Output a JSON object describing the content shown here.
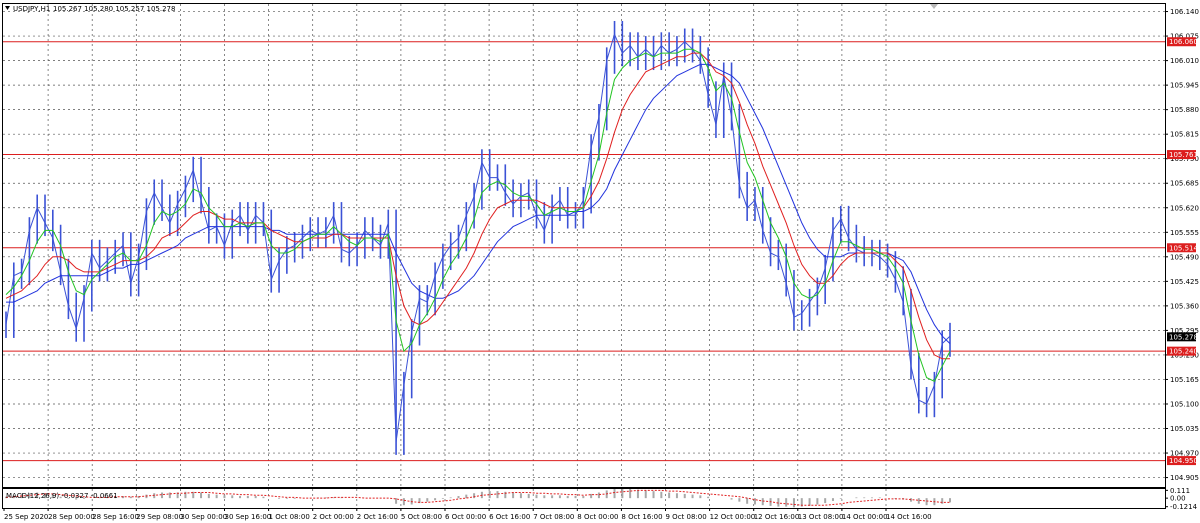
{
  "header": {
    "symbol_timeframe": "USDJPY,H1",
    "ohlc": "105.267 105.280 105.257 105.278"
  },
  "macd_label": "MACD(12,26,9) -0.0327 -0.0661",
  "colors": {
    "price": "#3b52d6",
    "fast_ma": "#22c422",
    "mid_ma": "#e02020",
    "slow_ma": "#2233dd",
    "level": "#dc1e1e",
    "current_price_tag": "#000000",
    "grid": "#555555",
    "macd_hist": "#a8a8a8",
    "macd_signal": "#e02020"
  },
  "chart_data": {
    "type": "line",
    "symbol": "USDJPY",
    "timeframe": "H1",
    "y_ticks": [
      "106.140",
      "106.075",
      "106.010",
      "105.945",
      "105.880",
      "105.815",
      "105.750",
      "105.685",
      "105.620",
      "105.555",
      "105.490",
      "105.425",
      "105.360",
      "105.295",
      "105.230",
      "105.165",
      "105.100",
      "105.035",
      "104.970",
      "104.905"
    ],
    "ylim": [
      104.88,
      106.16
    ],
    "x_ticks": [
      "25 Sep 2020",
      "28 Sep 00:00",
      "28 Sep 16:00",
      "29 Sep 08:00",
      "30 Sep 00:00",
      "30 Sep 16:00",
      "1 Oct 08:00",
      "2 Oct 00:00",
      "2 Oct 16:00",
      "5 Oct 08:00",
      "6 Oct 00:00",
      "6 Oct 16:00",
      "7 Oct 08:00",
      "8 Oct 00:00",
      "8 Oct 16:00",
      "9 Oct 08:00",
      "12 Oct 00:00",
      "12 Oct 16:00",
      "13 Oct 08:00",
      "14 Oct 00:00",
      "14 Oct 16:00"
    ],
    "levels": [
      {
        "label": "106.060",
        "value": 106.06
      },
      {
        "label": "105.761",
        "value": 105.761
      },
      {
        "label": "105.514",
        "value": 105.514
      },
      {
        "label": "105.240",
        "value": 105.24
      },
      {
        "label": "104.950",
        "value": 104.95
      }
    ],
    "current_price": "105.278",
    "price": [
      105.31,
      105.44,
      105.45,
      105.56,
      105.62,
      105.58,
      105.54,
      105.45,
      105.36,
      105.3,
      105.38,
      105.5,
      105.46,
      105.48,
      105.5,
      105.52,
      105.42,
      105.49,
      105.61,
      105.66,
      105.62,
      105.58,
      105.63,
      105.67,
      105.72,
      105.64,
      105.56,
      105.57,
      105.52,
      105.58,
      105.6,
      105.56,
      105.6,
      105.58,
      105.43,
      105.48,
      105.51,
      105.52,
      105.54,
      105.56,
      105.55,
      105.56,
      105.6,
      105.51,
      105.5,
      105.52,
      105.56,
      105.54,
      105.52,
      105.58,
      105.0,
      105.15,
      105.29,
      105.38,
      105.37,
      105.44,
      105.49,
      105.52,
      105.54,
      105.6,
      105.65,
      105.74,
      105.7,
      105.7,
      105.66,
      105.63,
      105.65,
      105.66,
      105.6,
      105.56,
      105.62,
      105.64,
      105.6,
      105.6,
      105.64,
      105.78,
      105.86,
      106.01,
      106.08,
      106.03,
      106.05,
      106.02,
      106.04,
      106.02,
      106.05,
      106.03,
      106.04,
      106.06,
      106.04,
      106.01,
      105.92,
      105.84,
      105.97,
      105.86,
      105.68,
      105.62,
      105.64,
      105.56,
      105.5,
      105.49,
      105.42,
      105.33,
      105.34,
      105.37,
      105.4,
      105.46,
      105.56,
      105.59,
      105.54,
      105.51,
      105.5,
      105.5,
      105.49,
      105.47,
      105.43,
      105.37,
      105.2,
      105.11,
      105.1,
      105.15,
      105.26,
      105.28
    ],
    "fast_ma": [
      105.39,
      105.41,
      105.44,
      105.48,
      105.53,
      105.56,
      105.56,
      105.52,
      105.45,
      105.4,
      105.39,
      105.43,
      105.45,
      105.47,
      105.49,
      105.5,
      105.48,
      105.48,
      105.52,
      105.58,
      105.61,
      105.6,
      105.61,
      105.63,
      105.67,
      105.66,
      105.62,
      105.6,
      105.57,
      105.57,
      105.58,
      105.57,
      105.58,
      105.58,
      105.52,
      105.5,
      105.5,
      105.51,
      105.53,
      105.54,
      105.55,
      105.55,
      105.57,
      105.55,
      105.53,
      105.52,
      105.54,
      105.54,
      105.53,
      105.55,
      105.32,
      105.24,
      105.26,
      105.31,
      105.34,
      105.38,
      105.43,
      105.47,
      105.5,
      105.54,
      105.59,
      105.66,
      105.68,
      105.69,
      105.68,
      105.66,
      105.65,
      105.65,
      105.63,
      105.6,
      105.61,
      105.62,
      105.61,
      105.61,
      105.62,
      105.69,
      105.76,
      105.87,
      105.96,
      105.99,
      106.01,
      106.02,
      106.03,
      106.02,
      106.03,
      106.03,
      106.03,
      106.04,
      106.04,
      106.03,
      105.99,
      105.93,
      105.95,
      105.91,
      105.82,
      105.74,
      105.7,
      105.64,
      105.58,
      105.54,
      105.49,
      105.42,
      105.39,
      105.38,
      105.39,
      105.42,
      105.48,
      105.53,
      105.53,
      105.52,
      105.51,
      105.51,
      105.5,
      105.49,
      105.46,
      105.42,
      105.32,
      105.23,
      105.17,
      105.16,
      105.2,
      105.24
    ],
    "mid_ma": [
      105.38,
      105.39,
      105.4,
      105.42,
      105.44,
      105.47,
      105.49,
      105.49,
      105.48,
      105.46,
      105.45,
      105.45,
      105.45,
      105.46,
      105.47,
      105.48,
      105.48,
      105.48,
      105.49,
      105.51,
      105.54,
      105.55,
      105.56,
      105.58,
      105.6,
      105.61,
      105.61,
      105.6,
      105.59,
      105.59,
      105.58,
      105.58,
      105.58,
      105.58,
      105.56,
      105.55,
      105.54,
      105.53,
      105.53,
      105.54,
      105.54,
      105.54,
      105.55,
      105.55,
      105.54,
      105.54,
      105.54,
      105.54,
      105.54,
      105.54,
      105.44,
      105.36,
      105.32,
      105.31,
      105.32,
      105.34,
      105.37,
      105.4,
      105.43,
      105.46,
      105.5,
      105.55,
      105.59,
      105.62,
      105.63,
      105.64,
      105.64,
      105.64,
      105.64,
      105.63,
      105.62,
      105.62,
      105.62,
      105.62,
      105.62,
      105.65,
      105.69,
      105.75,
      105.82,
      105.88,
      105.92,
      105.95,
      105.98,
      105.99,
      106.0,
      106.01,
      106.02,
      106.02,
      106.03,
      106.03,
      106.01,
      105.98,
      105.97,
      105.95,
      105.9,
      105.84,
      105.79,
      105.73,
      105.68,
      105.63,
      105.58,
      105.52,
      105.47,
      105.44,
      105.42,
      105.42,
      105.44,
      105.47,
      105.49,
      105.5,
      105.5,
      105.5,
      105.5,
      105.5,
      105.48,
      105.46,
      105.4,
      105.33,
      105.27,
      105.23,
      105.22,
      105.22
    ],
    "slow_ma": [
      105.37,
      105.37,
      105.38,
      105.39,
      105.4,
      105.42,
      105.43,
      105.44,
      105.44,
      105.44,
      105.44,
      105.44,
      105.44,
      105.45,
      105.46,
      105.46,
      105.47,
      105.47,
      105.48,
      105.49,
      105.5,
      105.51,
      105.52,
      105.54,
      105.55,
      105.56,
      105.57,
      105.57,
      105.57,
      105.57,
      105.57,
      105.57,
      105.57,
      105.57,
      105.56,
      105.56,
      105.55,
      105.55,
      105.55,
      105.55,
      105.55,
      105.55,
      105.55,
      105.55,
      105.55,
      105.55,
      105.55,
      105.55,
      105.55,
      105.55,
      105.5,
      105.46,
      105.42,
      105.4,
      105.39,
      105.38,
      105.38,
      105.39,
      105.4,
      105.42,
      105.44,
      105.47,
      105.5,
      105.53,
      105.55,
      105.57,
      105.58,
      105.59,
      105.6,
      105.6,
      105.6,
      105.6,
      105.6,
      105.61,
      105.61,
      105.62,
      105.64,
      105.67,
      105.72,
      105.76,
      105.8,
      105.84,
      105.88,
      105.91,
      105.93,
      105.95,
      105.97,
      105.98,
      105.99,
      106.0,
      106.0,
      105.99,
      105.98,
      105.97,
      105.95,
      105.91,
      105.87,
      105.83,
      105.78,
      105.73,
      105.68,
      105.63,
      105.58,
      105.54,
      105.51,
      105.49,
      105.49,
      105.49,
      105.5,
      105.5,
      105.5,
      105.5,
      105.5,
      105.5,
      105.49,
      105.48,
      105.45,
      105.4,
      105.35,
      105.31,
      105.28,
      105.26
    ],
    "macd": {
      "y_ticks": [
        "0.111",
        "0.00",
        "-0.1214"
      ],
      "ylim": [
        -0.14,
        0.13
      ],
      "histogram": [
        0.02,
        0.04,
        0.06,
        0.07,
        0.08,
        0.07,
        0.05,
        0.02,
        -0.01,
        -0.02,
        -0.01,
        0.0,
        0.01,
        0.02,
        0.03,
        0.03,
        0.02,
        0.03,
        0.05,
        0.07,
        0.08,
        0.08,
        0.08,
        0.09,
        0.09,
        0.08,
        0.06,
        0.05,
        0.04,
        0.04,
        0.03,
        0.03,
        0.03,
        0.02,
        0.0,
        -0.01,
        -0.01,
        -0.01,
        0.0,
        0.0,
        0.01,
        0.01,
        0.01,
        0.01,
        0.0,
        0.0,
        0.0,
        0.0,
        0.0,
        0.0,
        -0.08,
        -0.1,
        -0.09,
        -0.07,
        -0.05,
        -0.03,
        -0.01,
        0.01,
        0.03,
        0.05,
        0.07,
        0.09,
        0.1,
        0.1,
        0.09,
        0.08,
        0.07,
        0.06,
        0.05,
        0.04,
        0.04,
        0.04,
        0.03,
        0.03,
        0.03,
        0.06,
        0.08,
        0.11,
        0.13,
        0.13,
        0.13,
        0.12,
        0.11,
        0.1,
        0.09,
        0.08,
        0.07,
        0.06,
        0.05,
        0.04,
        0.02,
        0.0,
        0.0,
        -0.02,
        -0.05,
        -0.08,
        -0.09,
        -0.1,
        -0.11,
        -0.12,
        -0.12,
        -0.13,
        -0.12,
        -0.11,
        -0.09,
        -0.07,
        -0.04,
        -0.01,
        0.0,
        0.01,
        0.01,
        0.01,
        0.01,
        0.0,
        -0.01,
        -0.02,
        -0.05,
        -0.08,
        -0.1,
        -0.1,
        -0.08,
        -0.06
      ],
      "signal": [
        0.01,
        0.02,
        0.03,
        0.04,
        0.05,
        0.06,
        0.06,
        0.05,
        0.04,
        0.03,
        0.02,
        0.01,
        0.01,
        0.01,
        0.02,
        0.02,
        0.02,
        0.02,
        0.03,
        0.04,
        0.05,
        0.06,
        0.07,
        0.07,
        0.08,
        0.08,
        0.08,
        0.07,
        0.06,
        0.06,
        0.05,
        0.05,
        0.04,
        0.04,
        0.03,
        0.02,
        0.01,
        0.01,
        0.0,
        0.0,
        0.0,
        0.0,
        0.01,
        0.01,
        0.01,
        0.01,
        0.0,
        0.0,
        0.0,
        0.0,
        -0.01,
        -0.03,
        -0.05,
        -0.06,
        -0.06,
        -0.05,
        -0.04,
        -0.03,
        -0.01,
        0.0,
        0.02,
        0.04,
        0.05,
        0.06,
        0.07,
        0.08,
        0.08,
        0.08,
        0.07,
        0.07,
        0.06,
        0.06,
        0.05,
        0.05,
        0.04,
        0.05,
        0.05,
        0.06,
        0.08,
        0.09,
        0.1,
        0.11,
        0.11,
        0.11,
        0.11,
        0.1,
        0.1,
        0.09,
        0.08,
        0.07,
        0.06,
        0.05,
        0.04,
        0.03,
        0.02,
        0.0,
        -0.02,
        -0.04,
        -0.05,
        -0.07,
        -0.08,
        -0.09,
        -0.1,
        -0.1,
        -0.1,
        -0.1,
        -0.09,
        -0.08,
        -0.06,
        -0.05,
        -0.04,
        -0.03,
        -0.02,
        -0.01,
        -0.01,
        -0.01,
        -0.02,
        -0.03,
        -0.04,
        -0.05,
        -0.06,
        -0.06
      ]
    }
  }
}
